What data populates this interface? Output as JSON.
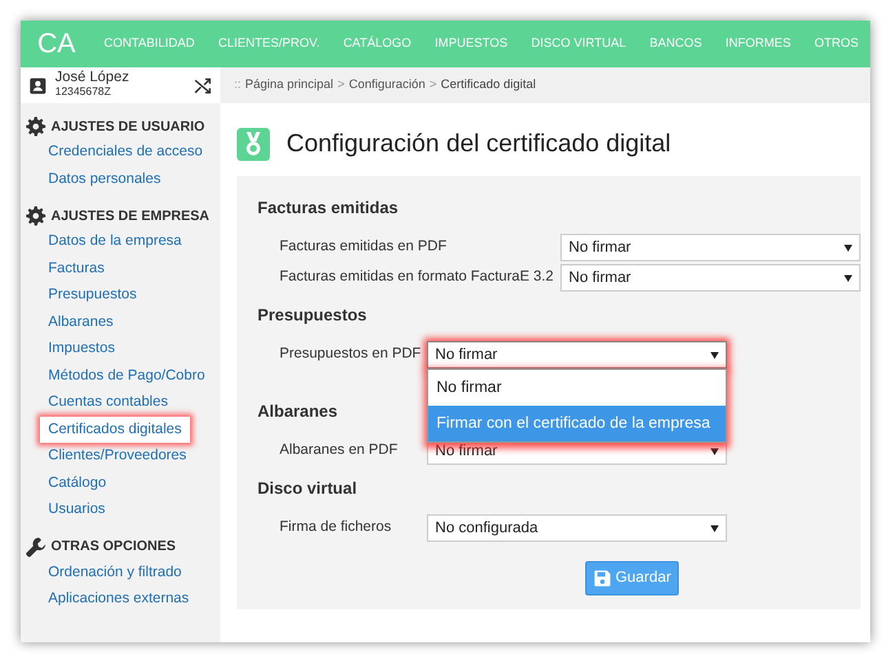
{
  "navbar": {
    "logo": "CA",
    "items": [
      "CONTABILIDAD",
      "CLIENTES/PROV.",
      "CATÁLOGO",
      "IMPUESTOS",
      "DISCO VIRTUAL",
      "BANCOS",
      "INFORMES",
      "OTROS"
    ]
  },
  "user": {
    "name": "José López",
    "id": "12345678Z"
  },
  "breadcrumb": [
    {
      "kind": "sep",
      "text": "::"
    },
    {
      "kind": "link",
      "text": "Página principal"
    },
    {
      "kind": "sep",
      "text": ">"
    },
    {
      "kind": "link",
      "text": "Configuración"
    },
    {
      "kind": "sep",
      "text": ">"
    },
    {
      "kind": "current",
      "text": "Certificado digital"
    }
  ],
  "sidebar": [
    {
      "title": "AJUSTES DE USUARIO",
      "items": [
        {
          "label": "Credenciales de acceso",
          "highlighted": false
        },
        {
          "label": "Datos personales",
          "highlighted": false
        }
      ]
    },
    {
      "title": "AJUSTES DE EMPRESA",
      "items": [
        {
          "label": "Datos de la empresa",
          "highlighted": false
        },
        {
          "label": "Facturas",
          "highlighted": false
        },
        {
          "label": "Presupuestos",
          "highlighted": false
        },
        {
          "label": "Albaranes",
          "highlighted": false
        },
        {
          "label": "Impuestos",
          "highlighted": false
        },
        {
          "label": "Métodos de Pago/Cobro",
          "highlighted": false
        },
        {
          "label": "Cuentas contables",
          "highlighted": false
        },
        {
          "label": "Certificados digitales",
          "highlighted": true
        },
        {
          "label": "Clientes/Proveedores",
          "highlighted": false
        },
        {
          "label": "Catálogo",
          "highlighted": false
        },
        {
          "label": "Usuarios",
          "highlighted": false
        }
      ]
    },
    {
      "title": "OTRAS OPCIONES",
      "items": [
        {
          "label": "Ordenación y filtrado",
          "highlighted": false
        },
        {
          "label": "Aplicaciones externas",
          "highlighted": false
        }
      ]
    }
  ],
  "page_title": "Configuración del certificado digital",
  "sections": [
    {
      "title": "Facturas emitidas",
      "fields": [
        {
          "label": "Facturas emitidas en PDF",
          "value": "No firmar",
          "highlighted": false
        },
        {
          "label": "Facturas emitidas en formato FacturaE 3.2",
          "value": "No firmar",
          "highlighted": false
        }
      ]
    },
    {
      "title": "Presupuestos",
      "fields": [
        {
          "label": "Presupuestos en PDF",
          "value": "No firmar",
          "highlighted": true,
          "options": [
            {
              "label": "No firmar",
              "hovered": false
            },
            {
              "label": "Firmar con el certificado de la empresa",
              "hovered": true
            }
          ]
        }
      ]
    },
    {
      "title": "Albaranes",
      "fields": [
        {
          "label": "Albaranes en PDF",
          "value": "No firmar",
          "highlighted": false
        }
      ]
    },
    {
      "title": "Disco virtual",
      "fields": [
        {
          "label": "Firma de ficheros",
          "value": "No configurada",
          "highlighted": false
        }
      ]
    }
  ],
  "save_button": "Guardar"
}
